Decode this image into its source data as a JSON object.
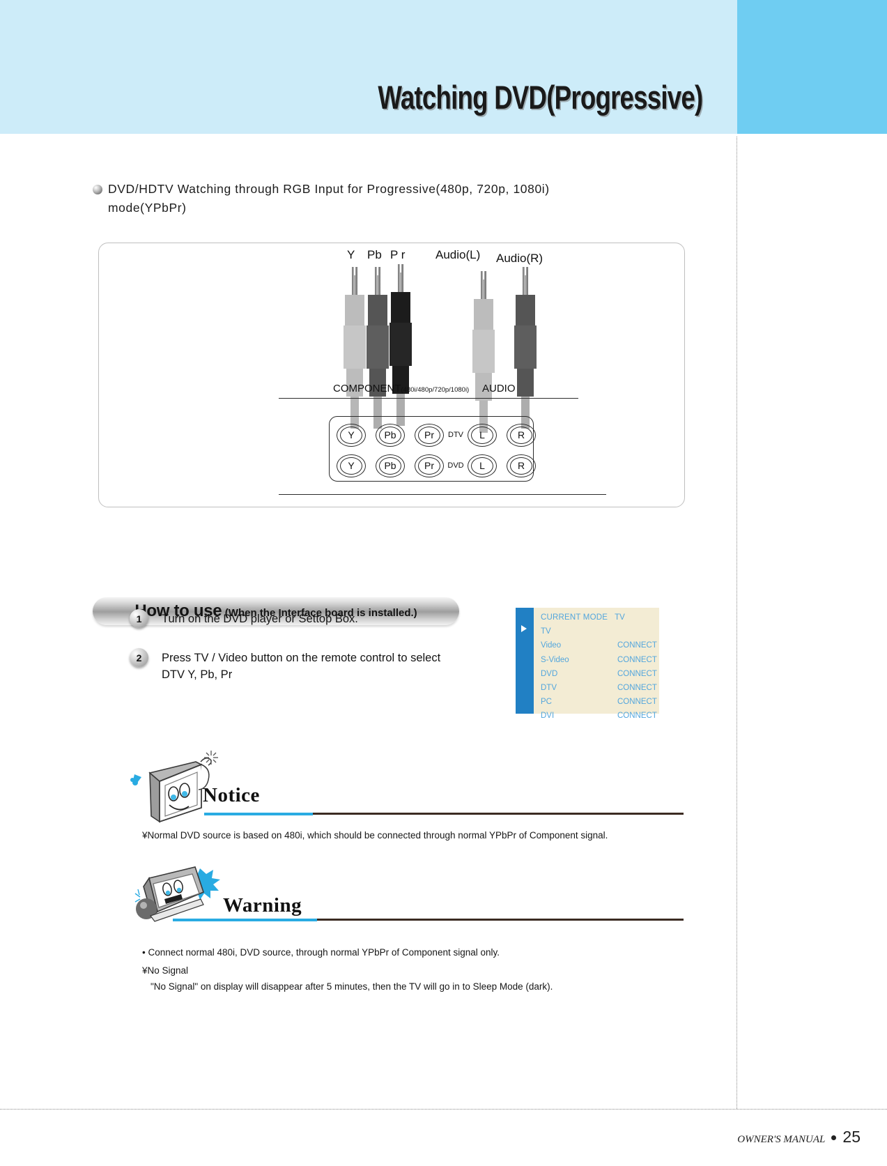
{
  "header": {
    "title": "Watching DVD(Progressive)",
    "band_color": "#cdecf9",
    "accent_color": "#6fcdf2"
  },
  "section": {
    "heading_line1": "DVD/HDTV Watching through RGB Input for Progressive(480p, 720p, 1080i)",
    "heading_line2": "mode(YPbPr)"
  },
  "diagram": {
    "plug_labels": [
      "Y",
      "Pb",
      "P r",
      "Audio(L)",
      "Audio(R)"
    ],
    "component_label": "COMPONENT",
    "component_sub": "(480i/480p/720p/1080i)",
    "audio_label": "AUDIO",
    "jack_rows": [
      {
        "jacks": [
          "Y",
          "Pb",
          "Pr"
        ],
        "mid": "DTV",
        "audio": [
          "L",
          "R"
        ]
      },
      {
        "jacks": [
          "Y",
          "Pb",
          "Pr"
        ],
        "mid": "DVD",
        "audio": [
          "L",
          "R"
        ]
      }
    ]
  },
  "howto": {
    "main": "How to use",
    "sub": "(When the Interface board is installed.)"
  },
  "steps": [
    {
      "num": "1",
      "text": "Turn on the DVD player or Settop Box."
    },
    {
      "num": "2",
      "text": "Press TV / Video button on the remote control to select\nDTV Y, Pb, Pr"
    }
  ],
  "osd": {
    "header_key": "CURRENT MODE",
    "header_value": "TV",
    "rows": [
      {
        "label": "TV",
        "value": ""
      },
      {
        "label": "Video",
        "value": "CONNECT"
      },
      {
        "label": "S-Video",
        "value": "CONNECT"
      },
      {
        "label": "DVD",
        "value": "CONNECT"
      },
      {
        "label": "DTV",
        "value": "CONNECT"
      },
      {
        "label": "PC",
        "value": "CONNECT"
      },
      {
        "label": "DVI",
        "value": "CONNECT"
      }
    ],
    "bg_color": "#f3ecd4",
    "bar_color": "#2180c4",
    "text_color": "#53a6dd"
  },
  "notice": {
    "title": "Notice",
    "line1": "¥Normal DVD source is based on 480i, which should be connected through normal YPbPr of Component signal."
  },
  "warning": {
    "title": "Warning",
    "line1": "• Connect normal 480i, DVD source, through normal YPbPr of Component signal only.",
    "line2": "¥No Signal",
    "line3": "\"No Signal\" on display will disappear after 5 minutes, then the TV will go in to Sleep Mode (dark)."
  },
  "footer": {
    "manual_text": "OWNER'S MANUAL",
    "page_number": "25"
  }
}
